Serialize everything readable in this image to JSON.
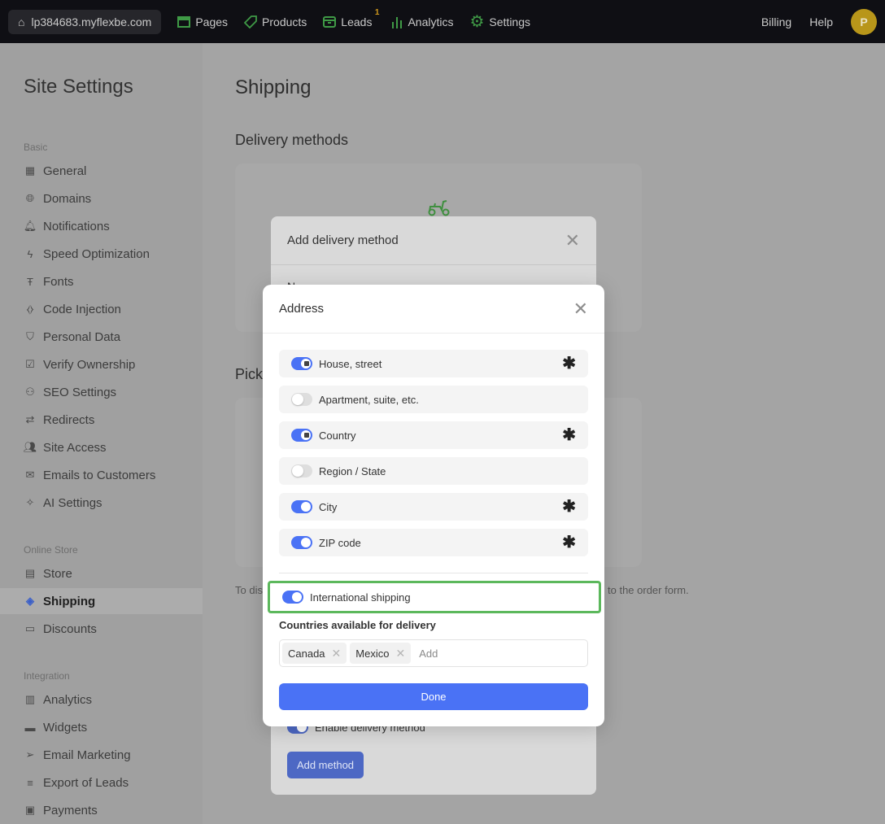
{
  "topbar": {
    "site": "lp384683.myflexbe.com",
    "nav": [
      {
        "label": "Pages",
        "icon": "pages-icon"
      },
      {
        "label": "Products",
        "icon": "tag-icon"
      },
      {
        "label": "Leads",
        "icon": "inbox-icon",
        "badge": "1"
      },
      {
        "label": "Analytics",
        "icon": "bar-chart-icon"
      },
      {
        "label": "Settings",
        "icon": "gear-icon"
      }
    ],
    "billing": "Billing",
    "help": "Help",
    "avatar": "P"
  },
  "sidebar": {
    "title": "Site Settings",
    "sections": [
      {
        "label": "Basic",
        "items": [
          "General",
          "Domains",
          "Notifications",
          "Speed Optimization",
          "Fonts",
          "Code Injection",
          "Personal Data",
          "Verify Ownership",
          "SEO Settings",
          "Redirects",
          "Site Access",
          "Emails to Customers",
          "AI Settings"
        ]
      },
      {
        "label": "Online Store",
        "items": [
          "Store",
          "Shipping",
          "Discounts"
        ]
      },
      {
        "label": "Integration",
        "items": [
          "Analytics",
          "Widgets",
          "Email Marketing",
          "Export of Leads",
          "Payments"
        ]
      }
    ],
    "active": "Shipping"
  },
  "main": {
    "title": "Shipping",
    "delivery_heading": "Delivery methods",
    "pickup_heading_partial": "Pick",
    "note_left": "To dis",
    "note_right": "to the order form."
  },
  "add_dialog": {
    "title": "Add delivery method",
    "field_partial": "N",
    "enable_label": "Enable delivery method",
    "add_button": "Add method"
  },
  "address_dialog": {
    "title": "Address",
    "fields": [
      {
        "label": "House, street",
        "enabled": true,
        "locked": true,
        "required": true
      },
      {
        "label": "Apartment, suite, etc.",
        "enabled": false,
        "locked": false,
        "required": false
      },
      {
        "label": "Country",
        "enabled": true,
        "locked": true,
        "required": true
      },
      {
        "label": "Region / State",
        "enabled": false,
        "locked": false,
        "required": false
      },
      {
        "label": "City",
        "enabled": true,
        "locked": false,
        "required": true
      },
      {
        "label": "ZIP code",
        "enabled": true,
        "locked": false,
        "required": true
      }
    ],
    "international": {
      "label": "International shipping",
      "enabled": true
    },
    "countries_label": "Countries available for delivery",
    "countries": [
      "Canada",
      "Mexico"
    ],
    "add_placeholder": "Add",
    "done": "Done"
  },
  "colors": {
    "accent": "#4a72f5",
    "highlight": "#5cb85c",
    "brand_green": "#3f8f3f"
  }
}
